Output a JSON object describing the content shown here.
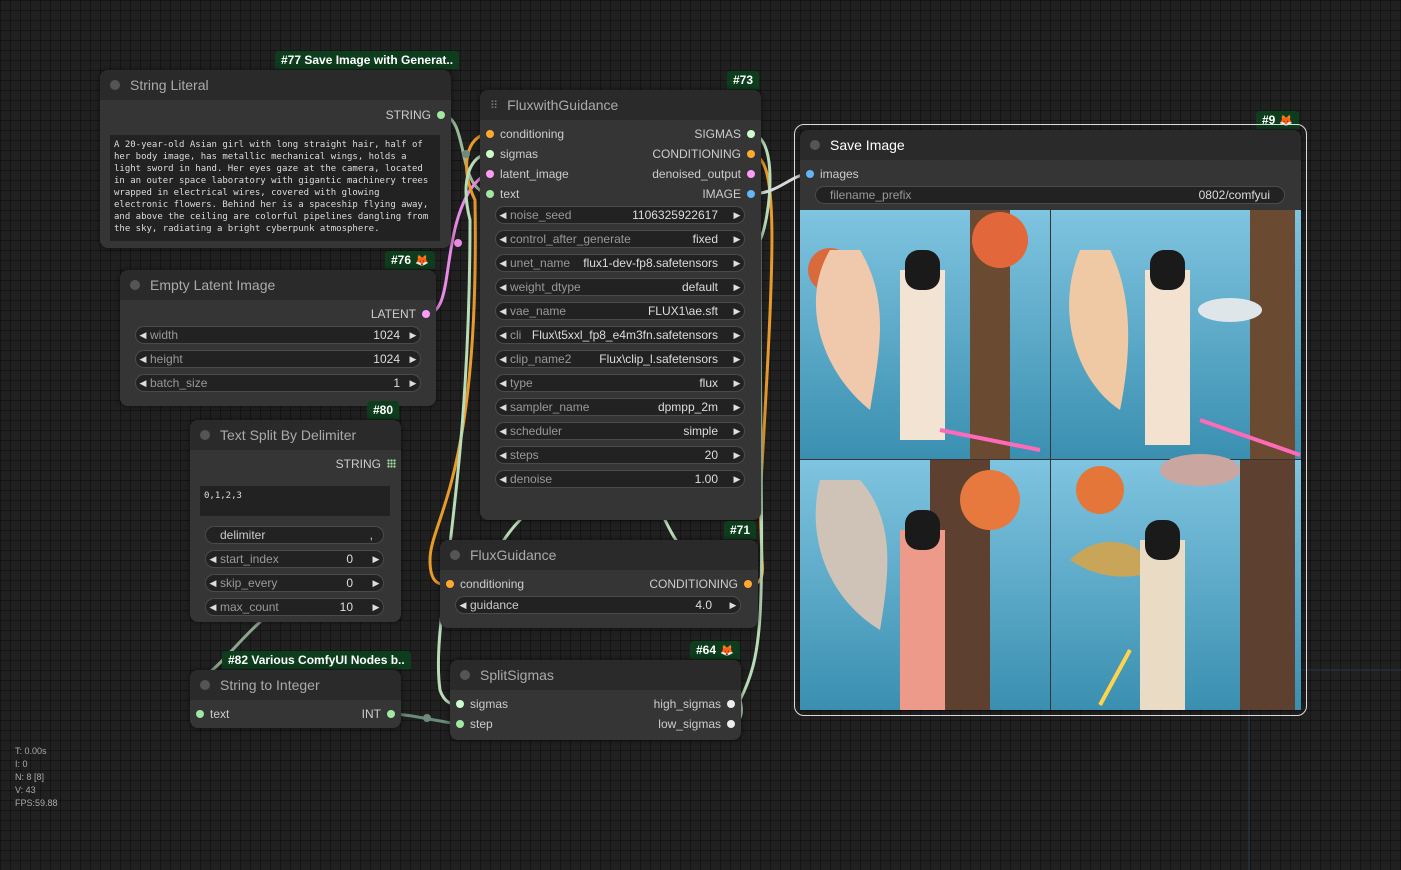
{
  "nodes": {
    "string_literal": {
      "badge": "#77 Save Image with Generat..",
      "title": "String Literal",
      "output": "STRING",
      "text": "A 20-year-old Asian girl with long straight hair, half of her body image, has metallic mechanical wings, holds a light sword in hand. Her eyes gaze at the camera, located in an outer space laboratory with gigantic machinery trees wrapped in electrical wires, covered with glowing electronic flowers. Behind her is a spaceship flying away, and above the ceiling are colorful pipelines dangling from the sky, radiating a bright cyberpunk atmosphere."
    },
    "empty_latent": {
      "badge": "#76",
      "title": "Empty Latent Image",
      "output": "LATENT",
      "widgets": [
        {
          "label": "width",
          "value": "1024"
        },
        {
          "label": "height",
          "value": "1024"
        },
        {
          "label": "batch_size",
          "value": "1"
        }
      ]
    },
    "text_split": {
      "badge": "#80",
      "title": "Text Split By Delimiter",
      "output": "STRING",
      "text": "0,1,2,3",
      "delimiter": {
        "label": "delimiter",
        "value": ","
      },
      "widgets": [
        {
          "label": "start_index",
          "value": "0"
        },
        {
          "label": "skip_every",
          "value": "0"
        },
        {
          "label": "max_count",
          "value": "10"
        }
      ]
    },
    "string_to_int": {
      "badge": "#82 Various ComfyUI Nodes b..",
      "title": "String to Integer",
      "input": "text",
      "output": "INT"
    },
    "flux_with_guidance": {
      "badge": "#73",
      "title": "FluxwithGuidance",
      "inputs": [
        "conditioning",
        "sigmas",
        "latent_image",
        "text"
      ],
      "outputs": [
        "SIGMAS",
        "CONDITIONING",
        "denoised_output",
        "IMAGE"
      ],
      "widgets": [
        {
          "label": "noise_seed",
          "value": "1106325922617"
        },
        {
          "label": "control_after_generate",
          "value": "fixed"
        },
        {
          "label": "unet_name",
          "value": "flux1-dev-fp8.safetensors"
        },
        {
          "label": "weight_dtype",
          "value": "default"
        },
        {
          "label": "vae_name",
          "value": "FLUX1\\ae.sft"
        },
        {
          "label": "cli",
          "value": "Flux\\t5xxl_fp8_e4m3fn.safetensors"
        },
        {
          "label": "clip_name2",
          "value": "Flux\\clip_l.safetensors"
        },
        {
          "label": "type",
          "value": "flux"
        },
        {
          "label": "sampler_name",
          "value": "dpmpp_2m"
        },
        {
          "label": "scheduler",
          "value": "simple"
        },
        {
          "label": "steps",
          "value": "20"
        },
        {
          "label": "denoise",
          "value": "1.00"
        }
      ]
    },
    "flux_guidance": {
      "badge": "#71",
      "title": "FluxGuidance",
      "input": "conditioning",
      "output": "CONDITIONING",
      "widget": {
        "label": "guidance",
        "value": "4.0"
      }
    },
    "split_sigmas": {
      "badge": "#64",
      "title": "SplitSigmas",
      "inputs": [
        "sigmas",
        "step"
      ],
      "outputs": [
        "high_sigmas",
        "low_sigmas"
      ]
    },
    "save_image": {
      "badge": "#9",
      "title": "Save Image",
      "input": "images",
      "filename_prefix": {
        "label": "filename_prefix",
        "value": "0802/comfyui"
      }
    }
  },
  "stats": [
    "T: 0.00s",
    "I: 0",
    "N: 8 [8]",
    "V: 43",
    "FPS:59.88"
  ],
  "colors": {
    "conditioning": "#ffa931",
    "sigmas": "#cdffcd",
    "latent": "#ff9cf9",
    "image": "#64b5f6",
    "string": "#a1e8a1",
    "badge_bg": "#0e3d1d"
  }
}
